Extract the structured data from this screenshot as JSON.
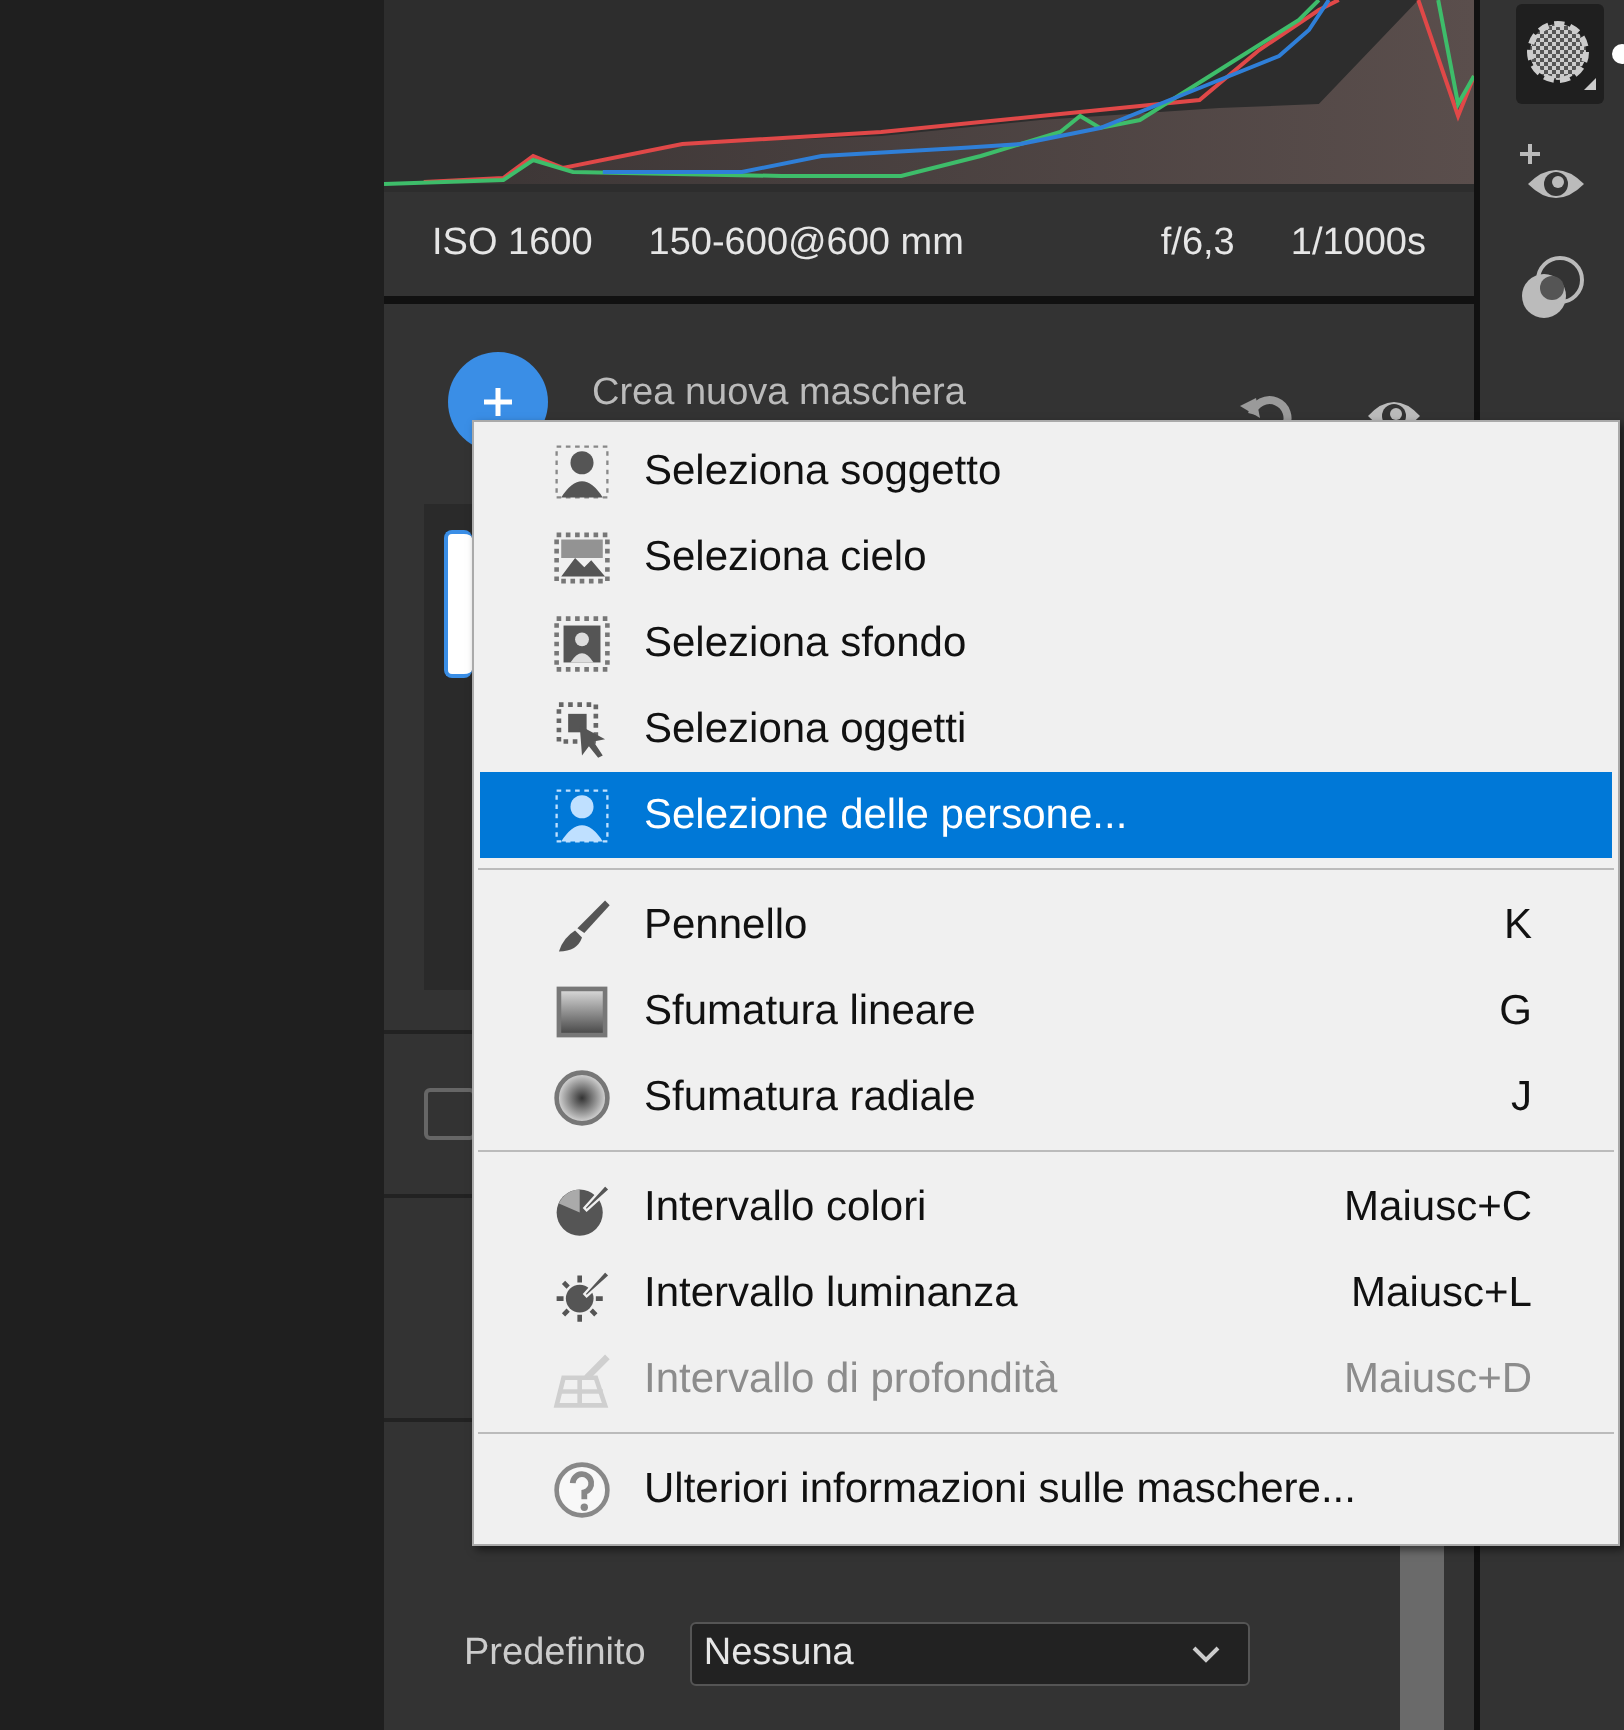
{
  "histogram": {
    "iso": "ISO 1600",
    "lens": "150-600@600 mm",
    "aperture": "f/6,3",
    "shutter": "1/1000s"
  },
  "masks": {
    "create_label": "Crea nuova maschera",
    "invert_checkbox": {
      "checked": false
    },
    "preset_label": "Predefinito",
    "preset_value": "Nessuna"
  },
  "menu": [
    [
      {
        "label": "Seleziona soggetto",
        "selected": false,
        "disabled": false
      },
      {
        "label": "Seleziona cielo",
        "selected": false,
        "disabled": false
      },
      {
        "label": "Seleziona sfondo",
        "selected": false,
        "disabled": false
      },
      {
        "label": "Seleziona oggetti",
        "selected": false,
        "disabled": false
      },
      {
        "label": "Selezione delle persone...",
        "selected": true,
        "disabled": false
      }
    ],
    [
      {
        "label": "Pennello",
        "shortcut": "K",
        "selected": false,
        "disabled": false
      },
      {
        "label": "Sfumatura lineare",
        "shortcut": "G",
        "selected": false,
        "disabled": false
      },
      {
        "label": "Sfumatura radiale",
        "shortcut": "J",
        "selected": false,
        "disabled": false
      }
    ],
    [
      {
        "label": "Intervallo colori",
        "shortcut": "Maiusc+C",
        "selected": false,
        "disabled": false
      },
      {
        "label": "Intervallo luminanza",
        "shortcut": "Maiusc+L",
        "selected": false,
        "disabled": false
      },
      {
        "label": "Intervallo di profondità",
        "shortcut": "Maiusc+D",
        "selected": false,
        "disabled": true
      }
    ],
    [
      {
        "label": "Ulteriori informazioni sulle maschere...",
        "selected": false,
        "disabled": false
      }
    ]
  ]
}
